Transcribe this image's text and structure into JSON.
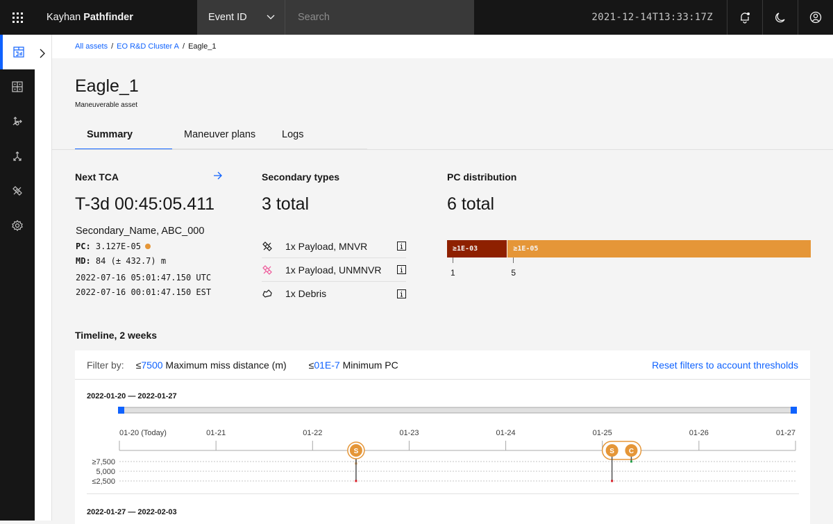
{
  "header": {
    "brand_light": "Kayhan",
    "brand_bold": "Pathfinder",
    "search_type": "Event ID",
    "search_placeholder": "Search",
    "timestamp": "2021-12-14T13:33:17Z"
  },
  "rail": {
    "items": [
      "dashboard",
      "assets",
      "maneuver",
      "network",
      "satellite",
      "settings"
    ]
  },
  "breadcrumb": [
    {
      "label": "All assets",
      "link": true
    },
    {
      "label": "EO R&D Cluster A",
      "link": true
    },
    {
      "label": "Eagle_1",
      "link": false
    }
  ],
  "page": {
    "title": "Eagle_1",
    "subtitle": "Maneuverable asset",
    "tabs": [
      {
        "label": "Summary",
        "active": true
      },
      {
        "label": "Maneuver plans",
        "active": false
      },
      {
        "label": "Logs",
        "active": false
      }
    ]
  },
  "next_tca": {
    "title": "Next TCA",
    "countdown": "T-3d 00:45:05.411",
    "secondary_name": "Secondary_Name, ABC_000",
    "pc_label": "PC:",
    "pc_value": "3.127E-05",
    "pc_color": "#e59638",
    "md_label": "MD:",
    "md_value": "84 (± 432.7) m",
    "utc": "2022-07-16 05:01:47.150 UTC",
    "est": "2022-07-16 00:01:47.150 EST"
  },
  "secondary_types": {
    "title": "Secondary types",
    "total": "3 total",
    "items": [
      {
        "icon": "payload-mnvr-icon",
        "label": "1x Payload, MNVR",
        "color": "#161616"
      },
      {
        "icon": "payload-unmnvr-icon",
        "label": "1x Payload, UNMNVR",
        "color": "#ee5396"
      },
      {
        "icon": "debris-icon",
        "label": "1x Debris",
        "color": "#161616"
      }
    ]
  },
  "pc_distribution": {
    "title": "PC distribution",
    "total": "6 total",
    "segments": [
      {
        "label": "≥1E-03",
        "count": 1,
        "color": "#8e2000"
      },
      {
        "label": "≥1E-05",
        "count": 5,
        "color": "#e59638"
      }
    ]
  },
  "timeline": {
    "title": "Timeline, 2 weeks",
    "filter_label": "Filter by:",
    "filters": [
      {
        "prefix": "≤",
        "value": "7500",
        "label": "Maximum miss distance (m)"
      },
      {
        "prefix": "≤",
        "value": "01E-7",
        "label": "Minimum PC"
      }
    ],
    "reset_label": "Reset filters to account thresholds",
    "weeks": [
      {
        "range": "2022-01-20 — 2022-01-27",
        "ticks": [
          "01-20 (Today)",
          "01-21",
          "01-22",
          "01-23",
          "01-24",
          "01-25",
          "01-26",
          "01-27"
        ],
        "y_labels": [
          "≥7,500",
          "5,000",
          "≤2,500"
        ],
        "events": [
          {
            "type": "S",
            "day": 2.45,
            "points": [
              {
                "md": 7000,
                "color": "#e59638"
              },
              {
                "md": 2500,
                "color": "#da1e28"
              }
            ]
          },
          {
            "type": "S",
            "day": 5.1,
            "points": [
              {
                "md": 2500,
                "color": "#da1e28"
              }
            ]
          },
          {
            "type": "C",
            "day": 5.3,
            "points": [
              {
                "md": 7500,
                "color": "#24a148"
              }
            ]
          }
        ]
      },
      {
        "range": "2022-01-27 — 2022-02-03"
      }
    ]
  }
}
